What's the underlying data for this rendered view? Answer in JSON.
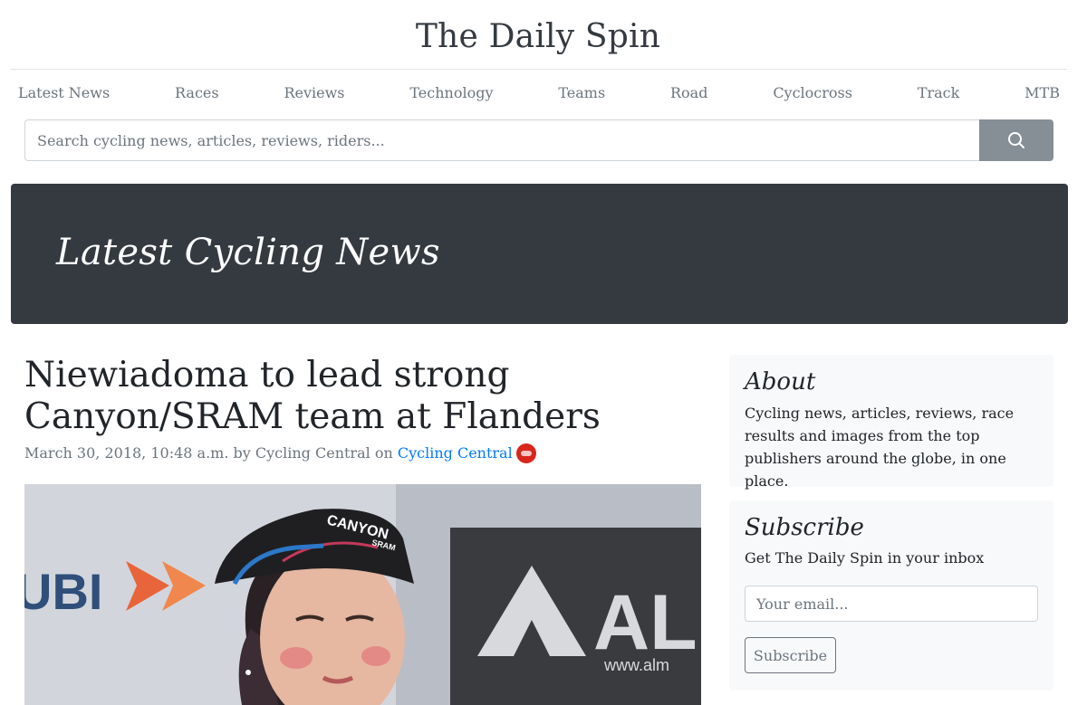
{
  "site": {
    "title": "The Daily Spin"
  },
  "nav": [
    {
      "label": "Latest News"
    },
    {
      "label": "Races"
    },
    {
      "label": "Reviews"
    },
    {
      "label": "Technology"
    },
    {
      "label": "Teams"
    },
    {
      "label": "Road"
    },
    {
      "label": "Cyclocross"
    },
    {
      "label": "Track"
    },
    {
      "label": "MTB"
    }
  ],
  "search": {
    "placeholder": "Search cycling news, articles, reviews, riders...",
    "icon": "search-icon"
  },
  "hero": {
    "title": "Latest Cycling News"
  },
  "article": {
    "title": "Niewiadoma to lead strong Canyon/SRAM team at Flanders",
    "meta_prefix": "March 30, 2018, 10:48 a.m. by Cycling Central on ",
    "source_link": "Cycling Central",
    "image_text": {
      "cap_brand": "CANYON",
      "cap_sub": "SRAM",
      "banner_left": "UBI",
      "banner_right": "ALN",
      "banner_small": "www.alm"
    }
  },
  "about": {
    "title": "About",
    "text": "Cycling news, articles, reviews, race results and images from the top publishers around the globe, in one place."
  },
  "subscribe": {
    "title": "Subscribe",
    "text": "Get The Daily Spin in your inbox",
    "email_placeholder": "Your email...",
    "button_label": "Subscribe"
  },
  "colors": {
    "hero_bg": "#343a40",
    "link": "#007bff",
    "muted": "#6c757d",
    "search_button": "#868e96",
    "card_bg": "#f8f9fa",
    "source_icon": "#d9261c"
  }
}
